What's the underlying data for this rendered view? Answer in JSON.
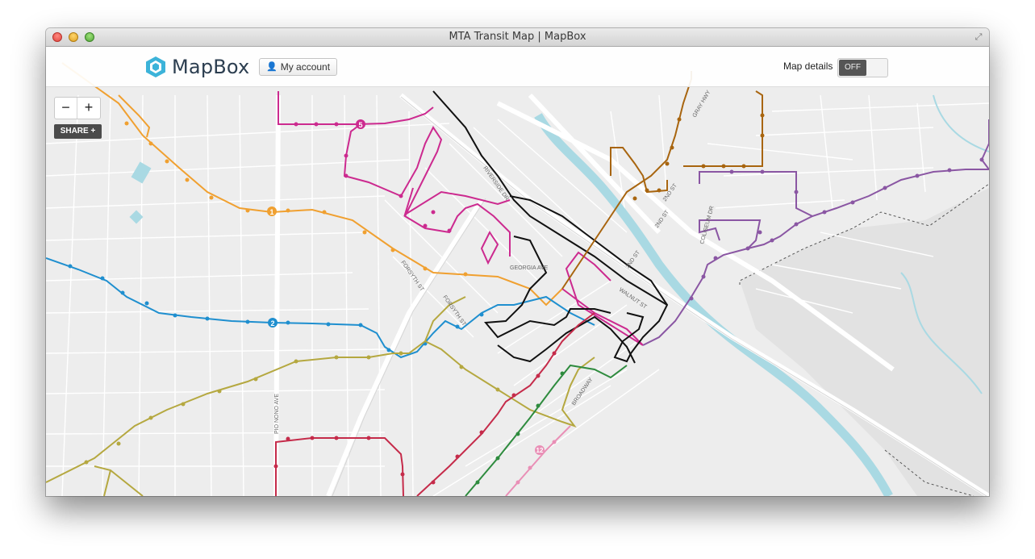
{
  "window": {
    "title": "MTA Transit Map | MapBox"
  },
  "header": {
    "logo_text": "MapBox",
    "account_label": "My account",
    "map_details_label": "Map details",
    "toggle_state": "OFF"
  },
  "controls": {
    "zoom_out": "−",
    "zoom_in": "+",
    "share_label": "SHARE +"
  },
  "streets": {
    "riverside": "RIVERSIDE DR",
    "georgia": "GEORGIA AVE",
    "forsyth1": "FORSYTH ST",
    "forsyth2": "FORSYTH ST",
    "walnut": "WALNUT ST",
    "broadway": "BROADWAY",
    "pio_nono": "PIO NONO AVE",
    "second1": "2ND ST",
    "second2": "2ND ST",
    "second3": "2ND ST",
    "gray_hwy": "GRAY HWY",
    "coliseum": "COLISEUM DR"
  },
  "routes": [
    {
      "id": "1",
      "color": "#f0a030"
    },
    {
      "id": "2",
      "color": "#1f8fcf"
    },
    {
      "id": "5",
      "color": "#cc2a8f"
    },
    {
      "id": "12",
      "color": "#e98fb6"
    }
  ],
  "colors": {
    "orange": "#f0a030",
    "blue": "#1f8fcf",
    "magenta": "#cc2a8f",
    "black": "#111111",
    "olive": "#b5a840",
    "red": "#c52b4a",
    "green": "#2e8b3e",
    "pink": "#e98fb6",
    "brown": "#a8650f",
    "purple": "#8a56a3",
    "river": "#a9d9e3"
  }
}
